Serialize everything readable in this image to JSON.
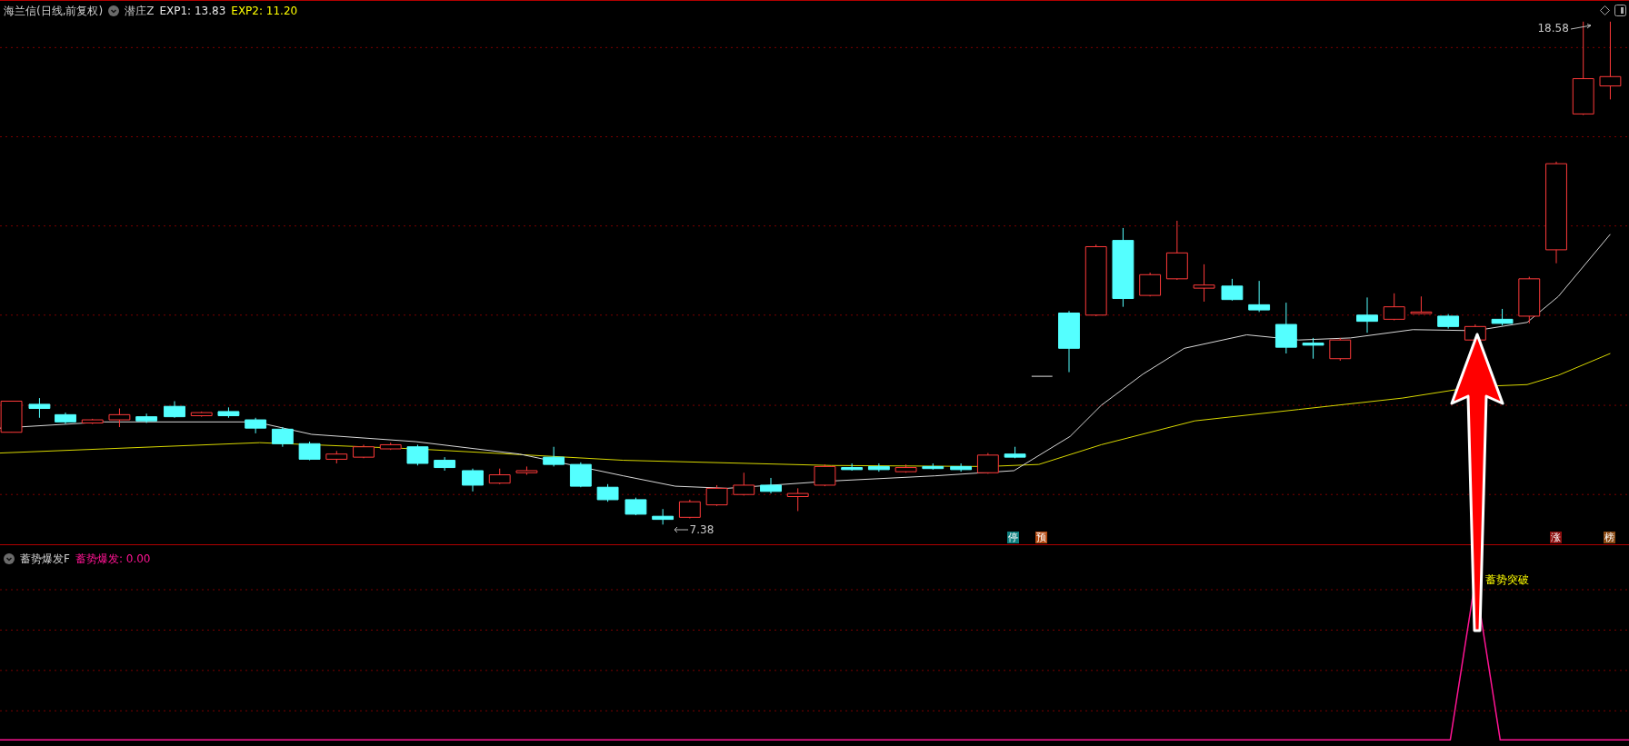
{
  "header": {
    "stock": "海兰信(日线,前复权)",
    "indicator": "潜庄Z",
    "values": [
      {
        "text": "EXP1: 13.83",
        "color": "#e8e8e8"
      },
      {
        "text": "EXP2: 11.20",
        "color": "#ffff00"
      }
    ]
  },
  "price_labels": [
    {
      "text": "18.58",
      "kind": "high"
    },
    {
      "text": "7.38",
      "kind": "low"
    }
  ],
  "markers": [
    {
      "text": "停",
      "color": "#0f8080"
    },
    {
      "text": "预",
      "color": "#b34a12"
    },
    {
      "text": "涨",
      "color": "#8b0f0f"
    },
    {
      "text": "榜",
      "color": "#8a4a14"
    }
  ],
  "lower_panel": {
    "indicator": "蓄势爆发F",
    "values": [
      {
        "text": "蓄势爆发: 0.00",
        "color": "#ff1493"
      }
    ],
    "signal_label": "蓄势突破"
  }
}
